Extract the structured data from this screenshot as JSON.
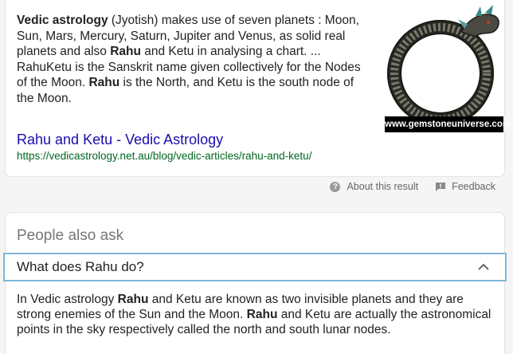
{
  "snippet": {
    "b1": "Vedic astrology",
    "t1": " (Jyotish) makes use of seven planets : Moon, Sun, Mars, Mercury, Saturn, Jupiter and Venus, as solid real planets and also ",
    "b2": "Rahu",
    "t2": " and Ketu in analysing a chart. ... RahuKetu is the Sanskrit name given collectively for the Nodes of the Moon. ",
    "b3": "Rahu",
    "t3": " is the North, and Ketu is the south node of the Moon."
  },
  "thumbnail": {
    "caption": "www.gemstoneuniverse.com"
  },
  "result": {
    "title": "Rahu and Ketu - Vedic Astrology",
    "url": "https://vedicastrology.net.au/blog/vedic-articles/rahu-and-ketu/"
  },
  "footer": {
    "about_label": "About this result",
    "feedback_label": "Feedback"
  },
  "paa": {
    "heading": "People also ask",
    "question": "What does Rahu do?",
    "answer": {
      "t1": "In Vedic astrology ",
      "b1": "Rahu",
      "t2": " and Ketu are known as two invisible planets and they are strong enemies of the Sun and the Moon. ",
      "b2": "Rahu",
      "t3": " and Ketu are actually the astronomical points in the sky respectively called the north and south lunar nodes."
    }
  },
  "colors": {
    "link": "#1a0dab",
    "url": "#006621",
    "focus_border": "#7fb5d9"
  },
  "icons": [
    "help-icon",
    "feedback-icon",
    "chevron-up-icon",
    "serpent-ring-image"
  ]
}
